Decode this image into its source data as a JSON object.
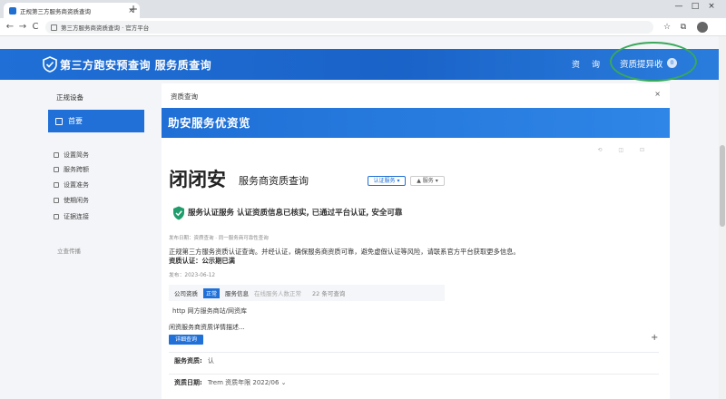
{
  "browser": {
    "tab_title": "正规第三方服务商资质查询",
    "new_tab": "+",
    "tab_close": "×",
    "url": "第三方服务商资质查询 · 官方平台",
    "nav": {
      "back": "←",
      "forward": "→",
      "reload": "C"
    },
    "window_controls": [
      "—",
      "□",
      "×"
    ],
    "toolbar_icons": [
      "☆",
      "⧉",
      "⬇"
    ]
  },
  "header": {
    "brand": "第三方跑安预查询  服务质查询",
    "nav_1": "资",
    "nav_2": "询",
    "action": "资质提异收",
    "action_badge": "0"
  },
  "sidebar": {
    "top": "正规设备",
    "active": "首要",
    "items": [
      "设置简务",
      "服务跨额",
      "设置准务",
      "使期闲务",
      "证据连接"
    ],
    "footer": "立查传播"
  },
  "panel": {
    "header": "资质查询",
    "close": "×",
    "banner": "助安服务优资览"
  },
  "card": {
    "toolbar": "⟲  ◫  ⊡",
    "title_big": "闭闭安",
    "title_small": "服务商资质查询",
    "chip_primary": "认证服务 ▾",
    "chip_secondary": "▲ 服务 ▾",
    "verified_text": "服务认证服务 认证资质信息已核实, 已通过平台认证, 安全可靠",
    "meta_line": "发布日期：资质查询 · 同一服务商可靠性查询",
    "paragraph": "正规第三方服务资质认证查询。并经认证，确保服务商资质可靠，避免虚假认证等风险，请联系官方平台获取更多信息。",
    "paragraph2": "资质认证：公示期已满",
    "meta_line2": "发布：2023-06-12",
    "info": {
      "label1": "公司资质",
      "tag": "正常",
      "label2": "服务信息",
      "label3": "在线服务人数正常",
      "count": "22 条可查询"
    },
    "web_line": "http  网方服务商站/网资库",
    "desc_line": "闲资服务商资质详情描述...",
    "view_button": "详细查询",
    "plus": "+",
    "rows": [
      {
        "k": "服务资质:",
        "v": "认"
      },
      {
        "k": "资质日期:",
        "v": "Trem 资质年限 2022/06 ⌄"
      }
    ]
  }
}
